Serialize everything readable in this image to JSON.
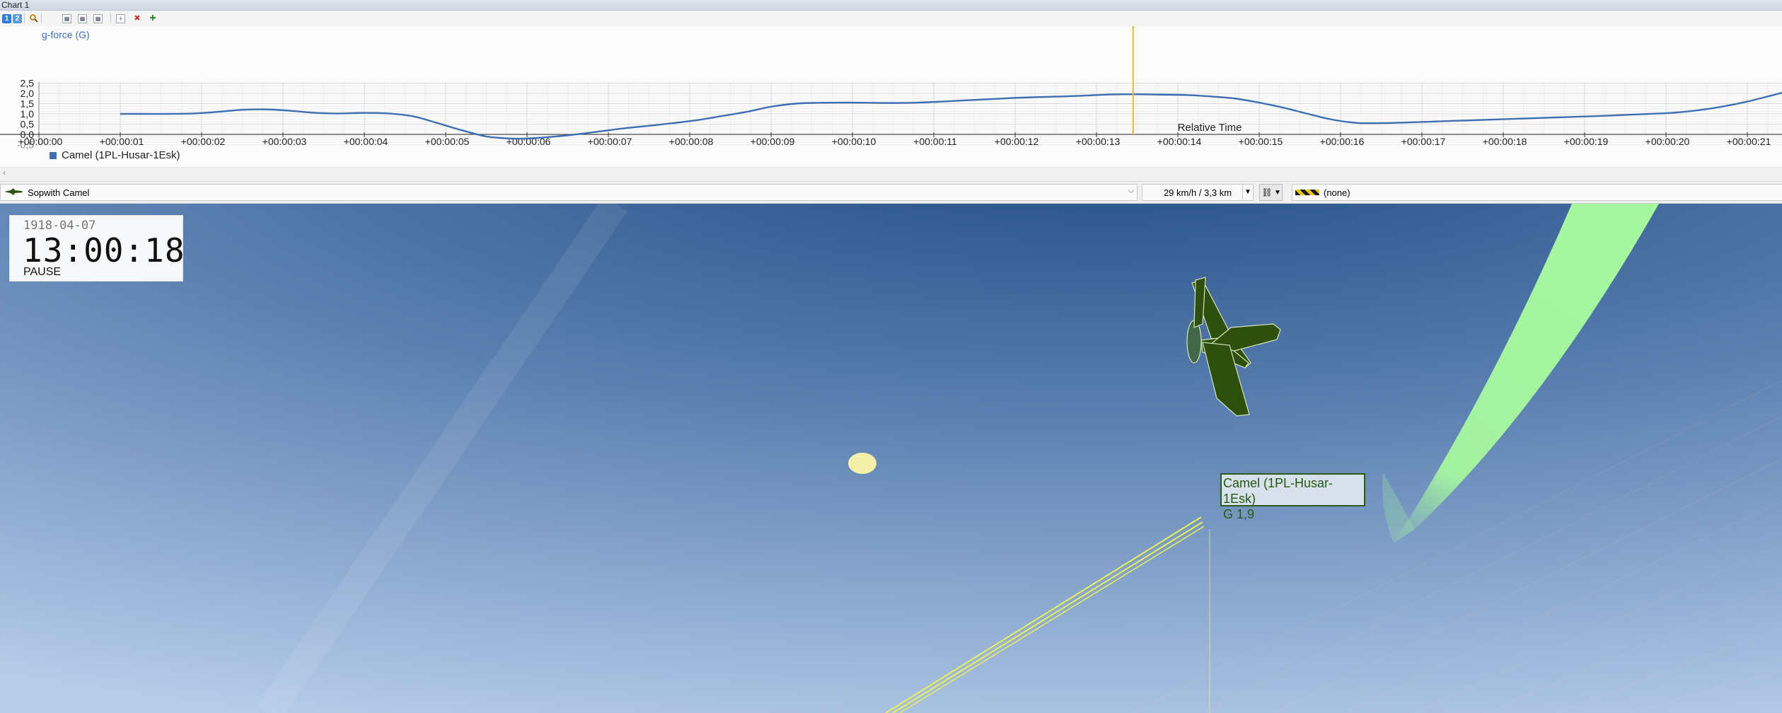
{
  "window": {
    "title": "Chart 1"
  },
  "toolbar": {
    "btn1": "1",
    "btn2": "2"
  },
  "chart": {
    "y_tick_labels": [
      "2,5",
      "2,0",
      "1,5",
      "1,0",
      "0,5",
      "0,0",
      "-0,5"
    ],
    "x_tick_labels": [
      "+00:00:00",
      "+00:00:01",
      "+00:00:02",
      "+00:00:03",
      "+00:00:04",
      "+00:00:05",
      "+00:00:06",
      "+00:00:07",
      "+00:00:08",
      "+00:00:09",
      "+00:00:10",
      "+00:00:11",
      "+00:00:12",
      "+00:00:13",
      "+00:00:14",
      "+00:00:15",
      "+00:00:16",
      "+00:00:17",
      "+00:00:18",
      "+00:00:19",
      "+00:00:20",
      "+00:00:21"
    ],
    "series_label": "g-force (G)",
    "x_axis_title": "Relative Time",
    "legend": "Camel (1PL-Husar-1Esk)",
    "cursor_time_s": 13.45,
    "colors": {
      "line": "#3f6fb3",
      "cursor": "#f3b52c",
      "grid": "#e4e4e4"
    }
  },
  "chart_data": {
    "type": "line",
    "ylabel": "g-force (G)",
    "xlabel": "Relative Time",
    "ylim": [
      -0.5,
      2.5
    ],
    "xlim": [
      0,
      21.8
    ],
    "grid": true,
    "legend_position": "bottom-left",
    "series": [
      {
        "name": "Camel (1PL-Husar-1Esk)",
        "x": [
          1.0,
          1.3,
          1.6,
          1.9,
          2.2,
          2.5,
          2.8,
          3.1,
          3.4,
          3.7,
          4.0,
          4.3,
          4.6,
          4.9,
          5.2,
          5.5,
          5.8,
          6.0,
          6.3,
          6.6,
          6.9,
          7.2,
          7.5,
          7.8,
          8.1,
          8.4,
          8.7,
          9.0,
          9.3,
          9.6,
          9.9,
          10.2,
          10.5,
          10.8,
          11.1,
          11.4,
          11.7,
          12.0,
          12.3,
          12.6,
          12.9,
          13.2,
          13.5,
          13.8,
          14.1,
          14.4,
          14.7,
          15.0,
          15.3,
          15.6,
          15.9,
          16.2,
          16.5,
          16.8,
          17.1,
          17.4,
          17.7,
          18.0,
          18.3,
          18.6,
          18.9,
          19.2,
          19.5,
          19.8,
          20.1,
          20.4,
          20.7,
          21.0,
          21.3,
          21.6,
          21.8
        ],
        "y": [
          1.0,
          1.0,
          1.0,
          1.02,
          1.1,
          1.2,
          1.22,
          1.15,
          1.05,
          1.02,
          1.05,
          1.02,
          0.88,
          0.55,
          0.2,
          -0.1,
          -0.2,
          -0.2,
          -0.12,
          0.0,
          0.15,
          0.3,
          0.42,
          0.55,
          0.7,
          0.9,
          1.1,
          1.35,
          1.5,
          1.54,
          1.55,
          1.54,
          1.53,
          1.55,
          1.6,
          1.66,
          1.72,
          1.78,
          1.82,
          1.85,
          1.9,
          1.95,
          1.96,
          1.94,
          1.92,
          1.85,
          1.75,
          1.55,
          1.3,
          1.0,
          0.72,
          0.56,
          0.55,
          0.58,
          0.62,
          0.66,
          0.7,
          0.74,
          0.78,
          0.82,
          0.86,
          0.9,
          0.95,
          1.0,
          1.06,
          1.18,
          1.36,
          1.6,
          1.9,
          2.2,
          2.28
        ]
      }
    ]
  },
  "statusbar": {
    "aircraft": "Sopwith Camel",
    "speed_scale": "29 km/h / 3,3 km",
    "track": "(none)"
  },
  "clock": {
    "date": "1918-04-07",
    "time": "13:00:18",
    "state": "PAUSE"
  },
  "aircraft_label": {
    "name": "Camel (1PL-Husar-1Esk)",
    "g": "G 1,9"
  },
  "scene": {
    "sky_top": "#2a5289",
    "sky_bottom": "#a9c3e6",
    "aircraft_color": "#2f4f0e",
    "trail_color": "#a6f7a0",
    "sun_color": "#f5f0a8"
  }
}
